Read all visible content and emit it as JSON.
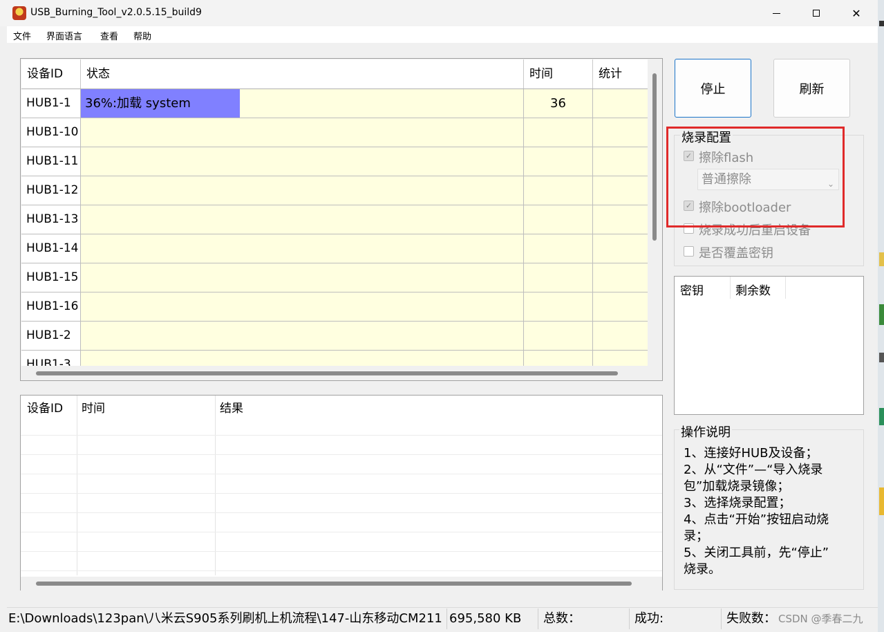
{
  "window": {
    "title": "USB_Burning_Tool_v2.0.5.15_build9",
    "minimize_icon": "minimize-icon",
    "maximize_icon": "maximize-icon",
    "close_glyph": "✕"
  },
  "menu": [
    "文件",
    "界面语言",
    "查看",
    "帮助"
  ],
  "device_table": {
    "headers": [
      "设备ID",
      "状态",
      "时间",
      "统计"
    ],
    "rows": [
      {
        "id": "HUB1-1",
        "status": "36%:加载 system",
        "progress_percent": 36,
        "time": "36"
      },
      {
        "id": "HUB1-10",
        "status": "",
        "time": ""
      },
      {
        "id": "HUB1-11",
        "status": "",
        "time": ""
      },
      {
        "id": "HUB1-12",
        "status": "",
        "time": ""
      },
      {
        "id": "HUB1-13",
        "status": "",
        "time": ""
      },
      {
        "id": "HUB1-14",
        "status": "",
        "time": ""
      },
      {
        "id": "HUB1-15",
        "status": "",
        "time": ""
      },
      {
        "id": "HUB1-16",
        "status": "",
        "time": ""
      },
      {
        "id": "HUB1-2",
        "status": "",
        "time": ""
      },
      {
        "id": "HUB1-3",
        "status": "",
        "time": ""
      }
    ],
    "progress_color": "#8080ff",
    "row_color": "#ffffe0"
  },
  "log_table": {
    "headers": [
      "设备ID",
      "时间",
      "结果"
    ]
  },
  "buttons": {
    "stop": "停止",
    "refresh": "刷新"
  },
  "burn_config": {
    "title": "烧录配置",
    "erase_flash": {
      "label": "擦除flash",
      "checked": true
    },
    "erase_mode": "普通擦除",
    "erase_bootloader": {
      "label": "擦除bootloader",
      "checked": true
    },
    "reboot_after": {
      "label": "烧录成功后重启设备",
      "checked": false
    },
    "overwrite_key": {
      "label": "是否覆盖密钥",
      "checked": false
    },
    "highlight_color": "#e02a2a"
  },
  "key_table": {
    "headers": [
      "密钥",
      "剩余数"
    ]
  },
  "instructions": {
    "title": "操作说明",
    "lines": [
      "1、连接好HUB及设备；",
      "2、从“文件”—“导入烧录",
      "包”加载烧录镜像；",
      "3、选择烧录配置；",
      "4、点击“开始”按钮启动烧",
      "录；",
      "5、关闭工具前，先“停止”",
      "烧录。"
    ]
  },
  "status_bar": {
    "path": "E:\\Downloads\\123pan\\八米云S905系列刷机上机流程\\147-山东移动CM211",
    "size": "695,580 KB",
    "total_label": "总数：",
    "success_label": "成功:",
    "fail_label": "失败数："
  },
  "watermark": "CSDN @季春二九"
}
